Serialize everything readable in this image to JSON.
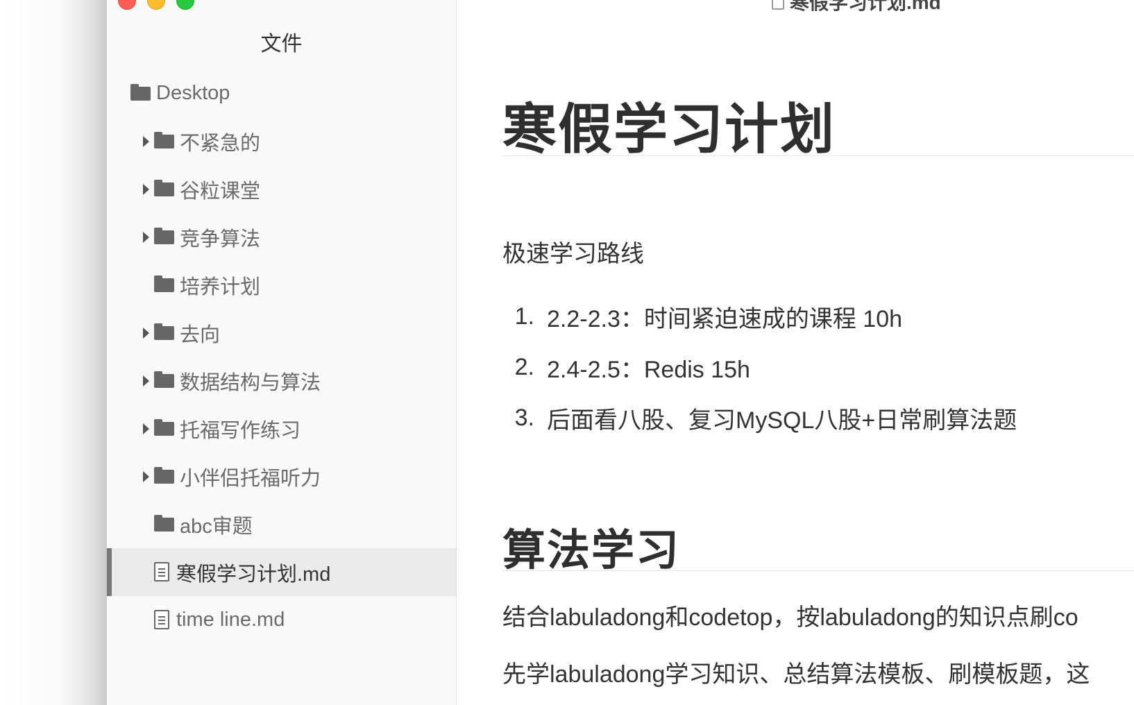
{
  "sidebar": {
    "title": "文件",
    "root": {
      "label": "Desktop"
    },
    "items": [
      {
        "label": "不紧急的",
        "type": "folder",
        "expandable": true
      },
      {
        "label": "谷粒课堂",
        "type": "folder",
        "expandable": true
      },
      {
        "label": "竞争算法",
        "type": "folder",
        "expandable": true
      },
      {
        "label": "培养计划",
        "type": "folder",
        "expandable": false
      },
      {
        "label": "去向",
        "type": "folder",
        "expandable": true
      },
      {
        "label": "数据结构与算法",
        "type": "folder",
        "expandable": true
      },
      {
        "label": "托福写作练习",
        "type": "folder",
        "expandable": true
      },
      {
        "label": "小伴侣托福听力",
        "type": "folder",
        "expandable": true
      },
      {
        "label": "abc审题",
        "type": "folder",
        "expandable": false
      },
      {
        "label": "寒假学习计划.md",
        "type": "file",
        "active": true
      },
      {
        "label": "time line.md",
        "type": "file"
      }
    ]
  },
  "editor": {
    "tab_title": "寒假学习计划.md",
    "h1": "寒假学习计划",
    "intro": "极速学习路线",
    "list": [
      {
        "num": "1.",
        "text": "2.2-2.3：时间紧迫速成的课程 10h"
      },
      {
        "num": "2.",
        "text": "2.4-2.5：Redis 15h"
      },
      {
        "num": "3.",
        "text": "后面看八股、复习MySQL八股+日常刷算法题"
      }
    ],
    "h2": "算法学习",
    "p1": "结合labuladong和codetop，按labuladong的知识点刷co",
    "p2": "先学labuladong学习知识、总结算法模板、刷模板题，这"
  }
}
